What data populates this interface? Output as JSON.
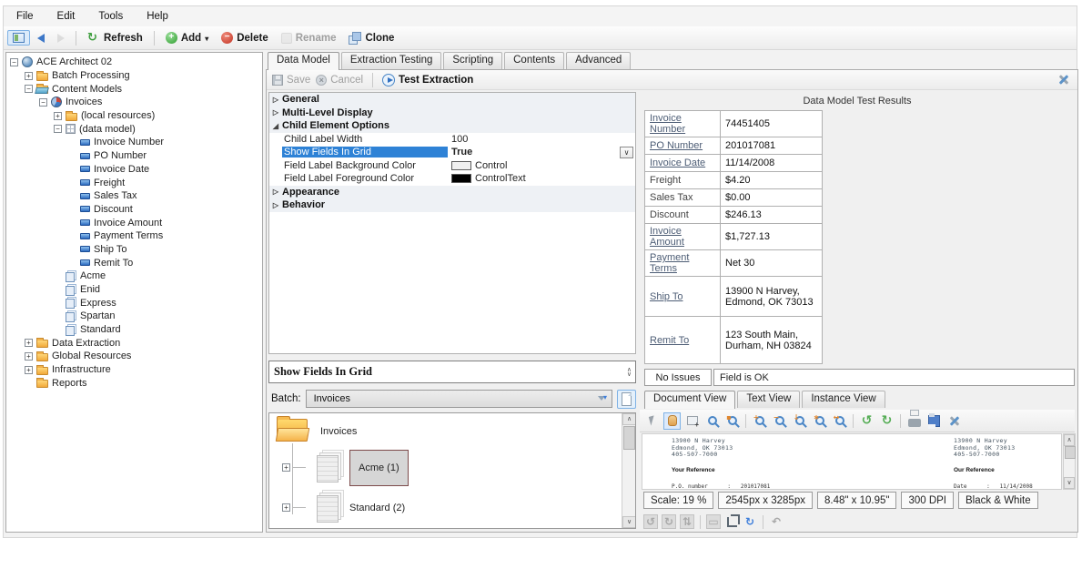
{
  "colors": {
    "accent": "#2e82d6",
    "selection_border": "#7d4a4a",
    "add_green": "#2f9e2f",
    "delete_red": "#c23323",
    "link": "#4d5d75"
  },
  "menu": [
    "File",
    "Edit",
    "Tools",
    "Help"
  ],
  "toolbar": {
    "items": [
      {
        "type": "button",
        "icon": "navigation-pane",
        "selected": true
      },
      {
        "type": "button",
        "icon": "back-arrow"
      },
      {
        "type": "button",
        "icon": "forward-arrow",
        "disabled": true
      },
      {
        "type": "sep"
      },
      {
        "type": "button",
        "icon": "refresh",
        "label": "Refresh"
      },
      {
        "type": "sep"
      },
      {
        "type": "button",
        "icon": "add",
        "label": "Add",
        "dropdown": true
      },
      {
        "type": "button",
        "icon": "delete",
        "label": "Delete"
      },
      {
        "type": "button",
        "icon": "rename",
        "label": "Rename",
        "disabled": true
      },
      {
        "type": "button",
        "icon": "clone",
        "label": "Clone"
      }
    ]
  },
  "nav_tree": {
    "items": [
      {
        "label": "ACE Architect 02",
        "depth": 0,
        "expander": "-",
        "icon": "server"
      },
      {
        "label": "Batch Processing",
        "depth": 1,
        "expander": "+",
        "icon": "folder"
      },
      {
        "label": "Content Models",
        "depth": 1,
        "expander": "-",
        "icon": "folder-open"
      },
      {
        "label": "Invoices",
        "depth": 2,
        "expander": "-",
        "icon": "content-model"
      },
      {
        "label": "(local resources)",
        "depth": 3,
        "expander": "+",
        "icon": "folder"
      },
      {
        "label": "(data model)",
        "depth": 3,
        "expander": "-",
        "icon": "data-grid"
      },
      {
        "label": "Invoice Number",
        "depth": 4,
        "expander": null,
        "icon": "field"
      },
      {
        "label": "PO Number",
        "depth": 4,
        "expander": null,
        "icon": "field"
      },
      {
        "label": "Invoice Date",
        "depth": 4,
        "expander": null,
        "icon": "field"
      },
      {
        "label": "Freight",
        "depth": 4,
        "expander": null,
        "icon": "field"
      },
      {
        "label": "Sales Tax",
        "depth": 4,
        "expander": null,
        "icon": "field"
      },
      {
        "label": "Discount",
        "depth": 4,
        "expander": null,
        "icon": "field"
      },
      {
        "label": "Invoice Amount",
        "depth": 4,
        "expander": null,
        "icon": "field"
      },
      {
        "label": "Payment Terms",
        "depth": 4,
        "expander": null,
        "icon": "field"
      },
      {
        "label": "Ship To",
        "depth": 4,
        "expander": null,
        "icon": "field"
      },
      {
        "label": "Remit To",
        "depth": 4,
        "expander": null,
        "icon": "field"
      },
      {
        "label": "Acme",
        "depth": 3,
        "expander": null,
        "icon": "document-stack"
      },
      {
        "label": "Enid",
        "depth": 3,
        "expander": null,
        "icon": "document-stack"
      },
      {
        "label": "Express",
        "depth": 3,
        "expander": null,
        "icon": "document-stack"
      },
      {
        "label": "Spartan",
        "depth": 3,
        "expander": null,
        "icon": "document-stack"
      },
      {
        "label": "Standard",
        "depth": 3,
        "expander": null,
        "icon": "document-stack"
      },
      {
        "label": "Data Extraction",
        "depth": 1,
        "expander": "+",
        "icon": "folder"
      },
      {
        "label": "Global Resources",
        "depth": 1,
        "expander": "+",
        "icon": "folder"
      },
      {
        "label": "Infrastructure",
        "depth": 1,
        "expander": "+",
        "icon": "folder"
      },
      {
        "label": "Reports",
        "depth": 1,
        "expander": null,
        "icon": "folder"
      }
    ]
  },
  "main_tabs": [
    {
      "label": "Data Model",
      "active": true
    },
    {
      "label": "Extraction Testing",
      "active": false
    },
    {
      "label": "Scripting",
      "active": false
    },
    {
      "label": "Contents",
      "active": false
    },
    {
      "label": "Advanced",
      "active": false
    }
  ],
  "editor_toolbar": {
    "save": "Save",
    "cancel": "Cancel",
    "test": "Test Extraction"
  },
  "property_grid": {
    "rows": [
      {
        "type": "category",
        "label": "General",
        "state": "collapsed"
      },
      {
        "type": "category",
        "label": "Multi-Level Display",
        "state": "collapsed"
      },
      {
        "type": "category",
        "label": "Child Element Options",
        "state": "expanded"
      },
      {
        "type": "property",
        "label": "Child Label Width",
        "value": "100"
      },
      {
        "type": "property",
        "label": "Show Fields In Grid",
        "value": "True",
        "selected": true,
        "dropdown": true,
        "value_bold": true
      },
      {
        "type": "property",
        "label": "Field Label Background Color",
        "value": "Control",
        "swatch": "#f0f0f0"
      },
      {
        "type": "property",
        "label": "Field Label Foreground Color",
        "value": "ControlText",
        "swatch": "#000000"
      },
      {
        "type": "category",
        "label": "Appearance",
        "state": "collapsed"
      },
      {
        "type": "category",
        "label": "Behavior",
        "state": "collapsed"
      }
    ]
  },
  "test_results": {
    "title": "Data Model Test Results",
    "rows": [
      {
        "label": "Invoice Number",
        "link": true,
        "lines": [
          "74451405"
        ]
      },
      {
        "label": "PO Number",
        "link": true,
        "lines": [
          "201017081"
        ]
      },
      {
        "label": "Invoice Date",
        "link": true,
        "lines": [
          "11/14/2008"
        ]
      },
      {
        "label": "Freight",
        "link": false,
        "lines": [
          "$4.20"
        ]
      },
      {
        "label": "Sales Tax",
        "link": false,
        "lines": [
          "$0.00"
        ]
      },
      {
        "label": "Discount",
        "link": false,
        "lines": [
          "$246.13"
        ]
      },
      {
        "label": "Invoice Amount",
        "link": true,
        "lines": [
          "$1,727.13"
        ]
      },
      {
        "label": "Payment Terms",
        "link": true,
        "lines": [
          "Net 30"
        ]
      },
      {
        "label": "Ship To",
        "link": true,
        "lines": [
          "13900 N Harvey,",
          "Edmond, OK 73013"
        ],
        "tall": 44
      },
      {
        "label": "Remit To",
        "link": true,
        "lines": [
          "123 South Main,",
          "Durham, NH 03824"
        ],
        "tall": 52
      }
    ]
  },
  "description_panel": {
    "title": "Show Fields In Grid"
  },
  "batch_bar": {
    "label": "Batch:",
    "value": "Invoices"
  },
  "batch_tree": {
    "root_label": "Invoices",
    "nodes": [
      {
        "label": "Acme (1)",
        "selected": true
      },
      {
        "label": "Standard (2)",
        "selected": false
      }
    ]
  },
  "issue_bar": {
    "status": "No Issues",
    "message": "Field is OK"
  },
  "view_tabs": [
    {
      "label": "Document View",
      "active": true
    },
    {
      "label": "Text View",
      "active": false
    },
    {
      "label": "Instance View",
      "active": false
    }
  ],
  "viewer_toolbar": {
    "items": [
      {
        "icon": "pointer"
      },
      {
        "icon": "pan-hand",
        "selected": true
      },
      {
        "icon": "select-zone"
      },
      {
        "icon": "zoom-selection",
        "glyph": ""
      },
      {
        "icon": "zoom-page",
        "glyph": "▪"
      },
      {
        "type": "sep"
      },
      {
        "icon": "zoom-in",
        "glyph": "+"
      },
      {
        "icon": "zoom-out",
        "glyph": "−"
      },
      {
        "icon": "zoom-actual",
        "glyph": "↓"
      },
      {
        "icon": "zoom-fit",
        "glyph": "∗"
      },
      {
        "icon": "zoom-width",
        "glyph": "↔"
      },
      {
        "type": "sep"
      },
      {
        "icon": "rotate-left",
        "glyph": "↺"
      },
      {
        "icon": "rotate-right",
        "glyph": "↻"
      },
      {
        "type": "sep"
      },
      {
        "icon": "print"
      },
      {
        "icon": "save-image"
      },
      {
        "icon": "image-tools"
      }
    ]
  },
  "preview": {
    "address_lines": [
      "13900 N Harvey",
      "Edmond, OK 73013",
      "405-507-7000"
    ],
    "your_reference": "Your Reference",
    "our_reference": "Our Reference",
    "po_line": "P.O. number      :   201017081",
    "date_line": "Date      :   11/14/2008"
  },
  "status_bar": [
    "Scale: 19 %",
    "2545px x 3285px",
    "8.48\" x 10.95\"",
    "300 DPI",
    "Black & White"
  ],
  "bottom_toolbar": {
    "items": [
      {
        "icon": "rotate-image-left",
        "glyph": "↺",
        "disabled": true,
        "boxed": true
      },
      {
        "icon": "rotate-image-right",
        "glyph": "↻",
        "disabled": true,
        "boxed": true
      },
      {
        "icon": "flip-image",
        "glyph": "⇅",
        "disabled": true,
        "boxed": true
      },
      {
        "type": "sep"
      },
      {
        "icon": "resize-image",
        "glyph": "▭",
        "disabled": true,
        "boxed": true
      },
      {
        "icon": "crop-image"
      },
      {
        "icon": "refresh-image",
        "glyph": "↻",
        "blue": true
      },
      {
        "type": "sep"
      },
      {
        "icon": "undo",
        "glyph": "↶",
        "disabled": true
      }
    ]
  }
}
